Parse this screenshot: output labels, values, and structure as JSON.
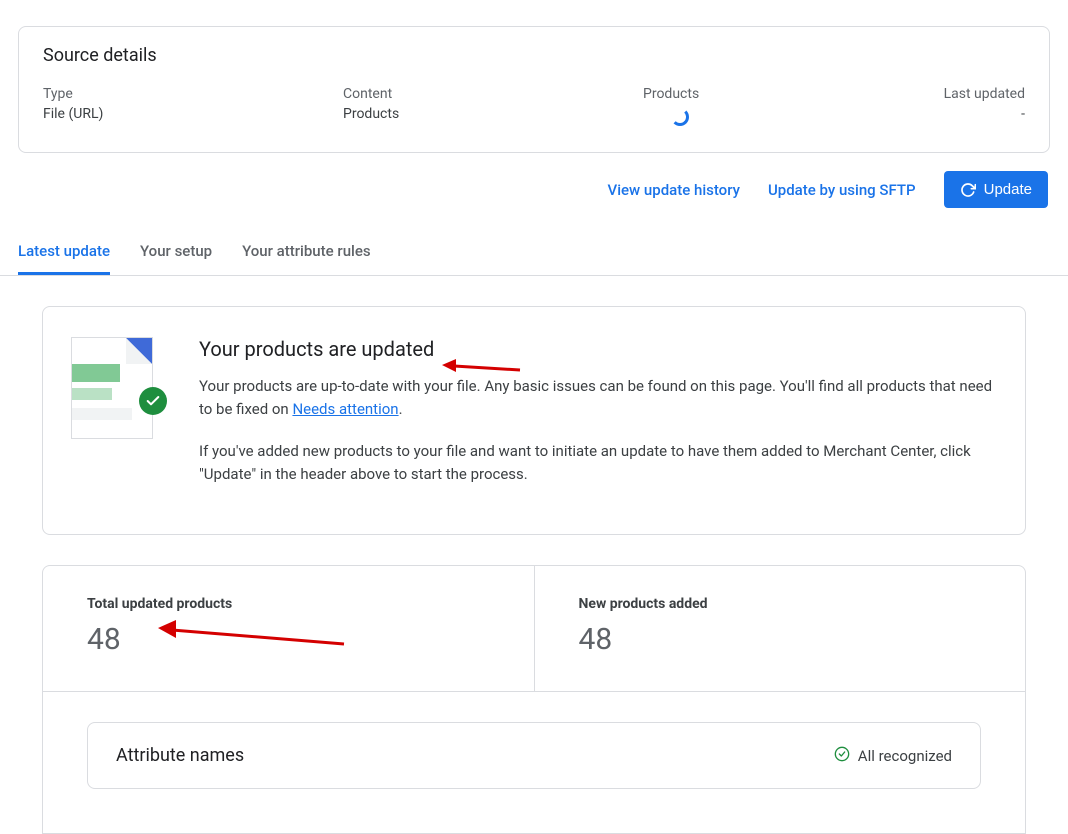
{
  "source": {
    "title": "Source details",
    "type_label": "Type",
    "type_value": "File (URL)",
    "content_label": "Content",
    "content_value": "Products",
    "products_label": "Products",
    "updated_label": "Last updated",
    "updated_value": "-"
  },
  "actions": {
    "history": "View update history",
    "sftp": "Update by using SFTP",
    "update": "Update"
  },
  "tabs": {
    "latest": "Latest update",
    "setup": "Your setup",
    "rules": "Your attribute rules"
  },
  "status": {
    "title": "Your products are updated",
    "para1_before": "Your products are up-to-date with your file. Any basic issues can be found on this page. You'll find all products that need to be fixed on ",
    "link": "Needs attention",
    "para1_after": ".",
    "para2": "If you've added new products to your file and want to initiate an update to have them added to Merchant Center, click \"Update\" in the header above to start the process."
  },
  "stats": {
    "total_label": "Total updated products",
    "total_value": "48",
    "new_label": "New products added",
    "new_value": "48"
  },
  "attrs": {
    "title": "Attribute names",
    "status": "All recognized"
  }
}
